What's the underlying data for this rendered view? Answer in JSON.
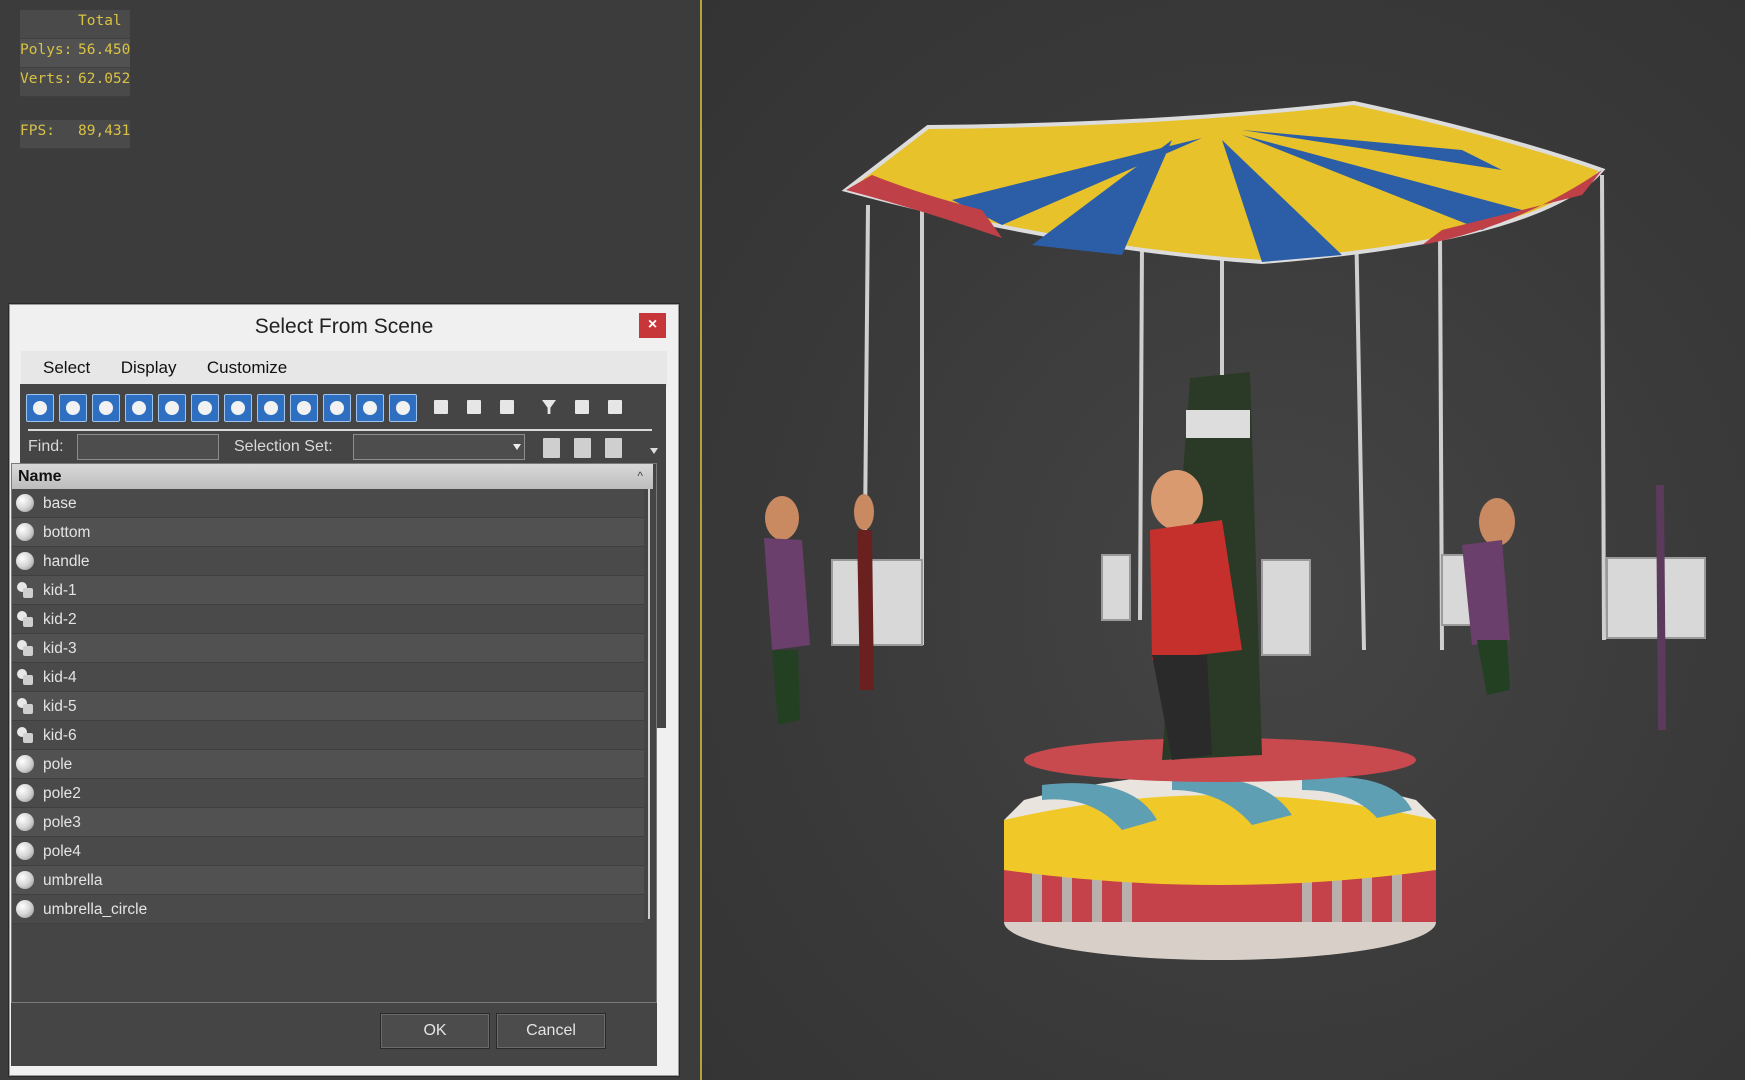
{
  "stats": {
    "total_label": "Total",
    "polys_label": "Polys:",
    "polys_value": "56.450",
    "verts_label": "Verts:",
    "verts_value": "62.052",
    "fps_label": "FPS:",
    "fps_value": "89,431"
  },
  "dialog": {
    "title": "Select From Scene",
    "close_glyph": "×",
    "menu": [
      "Select",
      "Display",
      "Customize"
    ],
    "find_label": "Find:",
    "find_value": "",
    "selection_set_label": "Selection Set:",
    "selection_set_value": "",
    "column_header": "Name",
    "sort_glyph": "^",
    "objects": [
      {
        "name": "base",
        "icon": "geometry-icon"
      },
      {
        "name": "bottom",
        "icon": "geometry-icon"
      },
      {
        "name": "handle",
        "icon": "geometry-icon"
      },
      {
        "name": "kid-1",
        "icon": "group-icon"
      },
      {
        "name": "kid-2",
        "icon": "group-icon"
      },
      {
        "name": "kid-3",
        "icon": "group-icon"
      },
      {
        "name": "kid-4",
        "icon": "group-icon"
      },
      {
        "name": "kid-5",
        "icon": "group-icon"
      },
      {
        "name": "kid-6",
        "icon": "group-icon"
      },
      {
        "name": "pole",
        "icon": "geometry-icon"
      },
      {
        "name": "pole2",
        "icon": "geometry-icon"
      },
      {
        "name": "pole3",
        "icon": "geometry-icon"
      },
      {
        "name": "pole4",
        "icon": "geometry-icon"
      },
      {
        "name": "umbrella",
        "icon": "geometry-icon"
      },
      {
        "name": "umbrella_circle",
        "icon": "geometry-icon"
      }
    ],
    "ok_label": "OK",
    "cancel_label": "Cancel"
  },
  "colors": {
    "stats_text": "#d8c244",
    "viewport_border": "#b3a33a",
    "active_tool": "#2f6fc2",
    "close_button": "#c7373a"
  }
}
